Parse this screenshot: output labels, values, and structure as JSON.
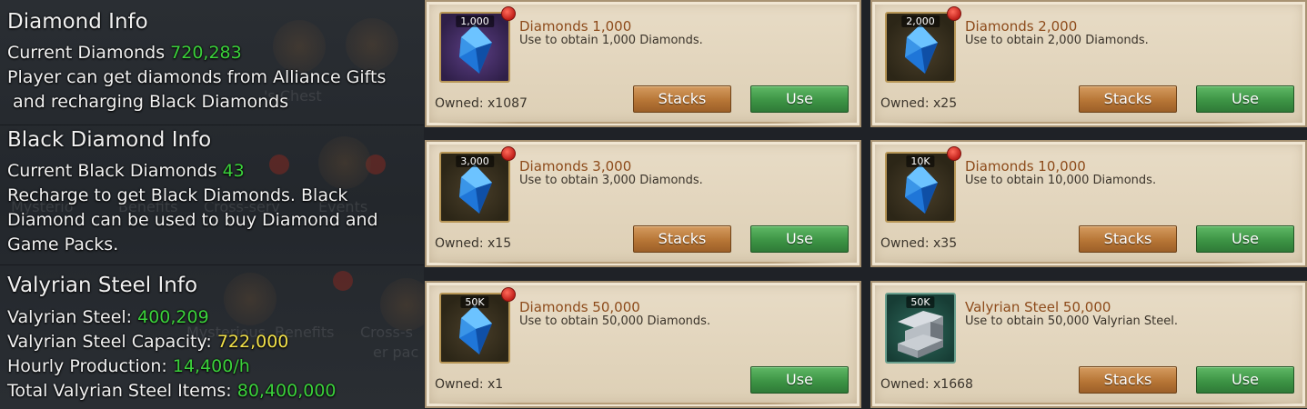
{
  "diamond_info": {
    "title": "Diamond Info",
    "current_label": "Current Diamonds",
    "current_value": "720,283",
    "desc_line1": "Player can get diamonds from Alliance Gifts",
    "desc_line2": " and recharging Black Diamonds"
  },
  "black_diamond_info": {
    "title": "Black Diamond Info",
    "current_label": "Current Black Diamonds",
    "current_value": "43",
    "desc_line1": "Recharge to get Black Diamonds. Black",
    "desc_line2": "Diamond can be used to buy Diamond and",
    "desc_line3": "Game Packs."
  },
  "valyrian_info": {
    "title": "Valyrian Steel Info",
    "steel_label": "Valyrian Steel:",
    "steel_value": "400,209",
    "capacity_label": "Valyrian Steel Capacity:",
    "capacity_value": "722,000",
    "hourly_label": "Hourly Production:",
    "hourly_value": "14,400/h",
    "total_label": "Total Valyrian Steel Items:",
    "total_value": "80,400,000"
  },
  "background_ghost_text": {
    "t1": "Mysterio",
    "t2": "Benefits",
    "t3": "Cross-serv",
    "t4": "Events",
    "t5": "Mysterious",
    "t6": "Benefits",
    "t7": "Cross-s",
    "t8": "er pac",
    "t9": "'s Chest"
  },
  "buttons": {
    "stacks_label": "Stacks",
    "use_label": "Use"
  },
  "items": [
    {
      "badge": "1,000",
      "name": "Diamonds 1,000",
      "desc": "Use to obtain 1,000 Diamonds.",
      "owned": "Owned: x1087",
      "icon": "blue-diamond-icon"
    },
    {
      "badge": "2,000",
      "name": "Diamonds 2,000",
      "desc": "Use to obtain 2,000 Diamonds.",
      "owned": "Owned: x25",
      "icon": "blue-diamond-icon"
    },
    {
      "badge": "3,000",
      "name": "Diamonds 3,000",
      "desc": "Use to obtain 3,000 Diamonds.",
      "owned": "Owned: x15",
      "icon": "blue-diamond-icon"
    },
    {
      "badge": "10K",
      "name": "Diamonds 10,000",
      "desc": "Use to obtain 10,000 Diamonds.",
      "owned": "Owned: x35",
      "icon": "blue-diamond-icon"
    },
    {
      "badge": "50K",
      "name": "Diamonds 50,000",
      "desc": "Use to obtain 50,000 Diamonds.",
      "owned": "Owned: x1",
      "icon": "blue-diamond-icon"
    },
    {
      "badge": "50K",
      "name": "Valyrian Steel 50,000",
      "desc": "Use to obtain 50,000 Valyrian Steel.",
      "owned": "Owned: x1668",
      "icon": "steel-ingot-icon"
    }
  ],
  "colors": {
    "highlight_green": "#3bd23b",
    "highlight_yellow": "#f3e24a",
    "item_name_brown": "#8d4b1b",
    "use_button_green": "#3d9445",
    "stacks_button_orange": "#b77636"
  }
}
